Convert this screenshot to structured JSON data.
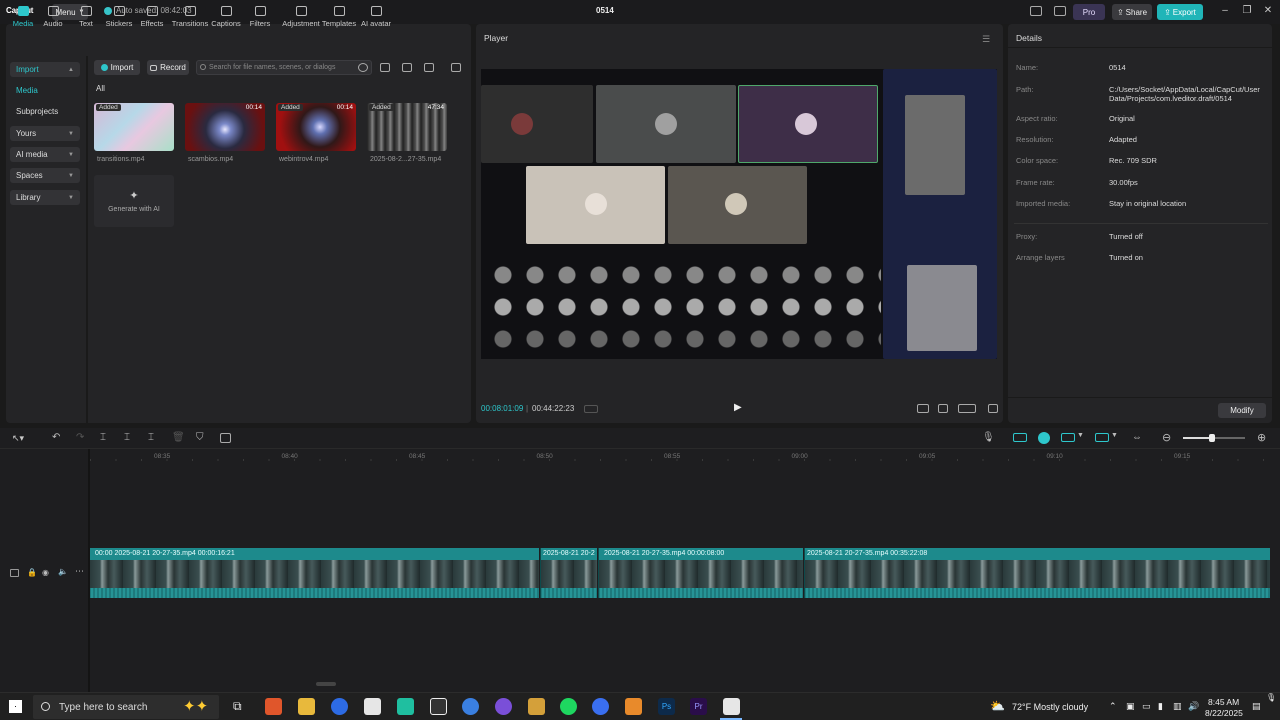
{
  "titlebar": {
    "logo": "CapCut",
    "menu_label": "Menu",
    "autosave": "Auto saved: 08:42:03",
    "project_name": "0514",
    "pro_label": "Pro",
    "share_label": "Share",
    "export_label": "Export"
  },
  "media_toolbar": [
    {
      "label": "Media",
      "icon": "media-icon"
    },
    {
      "label": "Audio",
      "icon": "audio-icon"
    },
    {
      "label": "Text",
      "icon": "text-icon"
    },
    {
      "label": "Stickers",
      "icon": "stickers-icon"
    },
    {
      "label": "Effects",
      "icon": "effects-icon"
    },
    {
      "label": "Transitions",
      "icon": "transitions-icon"
    },
    {
      "label": "Captions",
      "icon": "captions-icon"
    },
    {
      "label": "Filters",
      "icon": "filters-icon"
    },
    {
      "label": "Adjustment",
      "icon": "adjustment-icon"
    },
    {
      "label": "Templates",
      "icon": "templates-icon"
    },
    {
      "label": "AI avatar",
      "icon": "ai-avatar-icon"
    }
  ],
  "sidebar": [
    {
      "label": "Import",
      "chev": "▲"
    },
    {
      "label": "Media",
      "chev": ""
    },
    {
      "label": "Subprojects",
      "chev": ""
    },
    {
      "label": "Yours",
      "chev": "▼"
    },
    {
      "label": "AI media",
      "chev": "▼"
    },
    {
      "label": "Spaces",
      "chev": "▼"
    },
    {
      "label": "Library",
      "chev": "▼"
    }
  ],
  "media": {
    "import_label": "Import",
    "record_label": "Record",
    "search_placeholder": "Search for file names, scenes, or dialogs",
    "filter_all": "All",
    "items": [
      {
        "name": "transitions.mp4",
        "badge": "Added",
        "duration": ""
      },
      {
        "name": "scambios.mp4",
        "badge": "",
        "duration": "00:14"
      },
      {
        "name": "webintrov4.mp4",
        "badge": "Added",
        "duration": "00:14"
      },
      {
        "name": "2025-08-2...27-35.mp4",
        "badge": "Added",
        "duration": "47:34"
      }
    ],
    "generate_label": "Generate with AI"
  },
  "player": {
    "title": "Player",
    "current_time": "00:08:01:09",
    "total_time": "00:44:22:23"
  },
  "details": {
    "title": "Details",
    "rows": [
      {
        "label": "Name:",
        "value": "0514"
      },
      {
        "label": "Path:",
        "value": "C:/Users/Socket/AppData/Local/CapCut/User Data/Projects/com.lveditor.draft/0514"
      },
      {
        "label": "Aspect ratio:",
        "value": "Original"
      },
      {
        "label": "Resolution:",
        "value": "Adapted"
      },
      {
        "label": "Color space:",
        "value": "Rec. 709 SDR"
      },
      {
        "label": "Frame rate:",
        "value": "30.00fps"
      },
      {
        "label": "Imported media:",
        "value": "Stay in original location"
      },
      {
        "label": "Proxy:",
        "value": "Turned off"
      },
      {
        "label": "Arrange layers",
        "value": "Turned on"
      }
    ],
    "modify_label": "Modify"
  },
  "timeline": {
    "ruler": [
      "08:35",
      "08:40",
      "08:45",
      "08:50",
      "08:55",
      "09:00",
      "09:05",
      "09:10",
      "09:15"
    ],
    "clips": [
      {
        "label": "00:00   2025-08-21 20-27-35.mp4   00:00:16:21"
      },
      {
        "label": "2025-08-21 20-2"
      },
      {
        "label": "2025-08-21 20-27-35.mp4   00:00:08:00"
      },
      {
        "label": "2025-08-21 20-27-35.mp4   00:35:22:08"
      }
    ]
  },
  "taskbar": {
    "search_placeholder": "Type here to search",
    "weather": "72°F  Mostly cloudy",
    "time": "8:45 AM",
    "date": "8/22/2025"
  }
}
